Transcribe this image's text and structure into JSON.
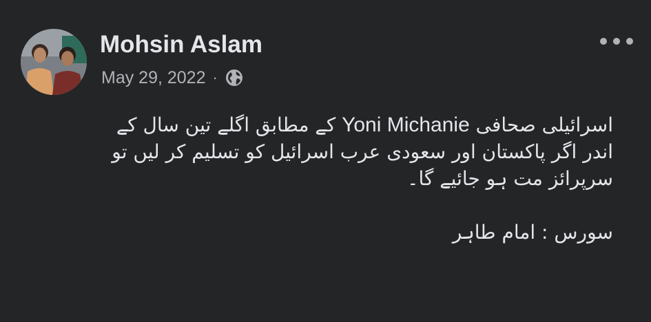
{
  "post": {
    "author": "Mohsin Aslam",
    "date": "May 29, 2022",
    "separator": "·",
    "privacy_icon": "globe-icon",
    "menu_icon": "more-options-icon",
    "body_lines": {
      "line1_part1": "اسرائیلی صحافی",
      "line1_name": "Yoni Michanie",
      "line1_part2": "کے مطابق اگلے تین سال کے",
      "line2": "اندر اگر پاکستان اور سعودی عرب اسرائیل کو تسلیم کر لیں تو",
      "line3": "سرپرائز مت ہو جائیے گا۔",
      "line4": "",
      "line5": "سورس : امام طاہر"
    }
  },
  "colors": {
    "background": "#242526",
    "primary_text": "#e4e6eb",
    "secondary_text": "#b0b3b8"
  }
}
